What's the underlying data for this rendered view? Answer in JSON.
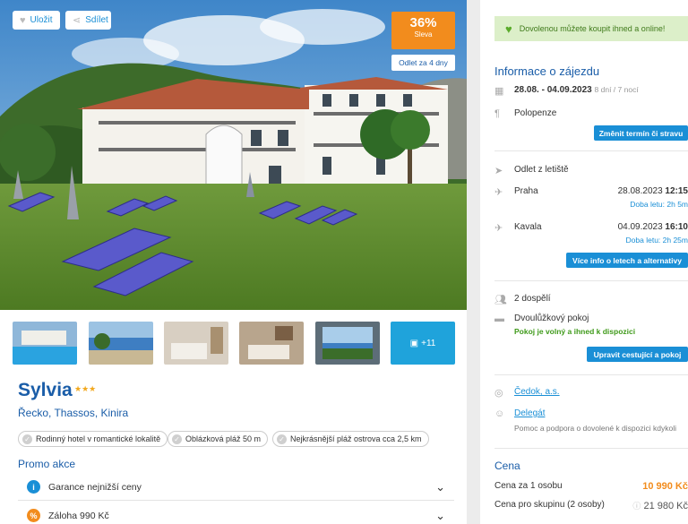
{
  "hero": {
    "save_label": "Uložit",
    "share_label": "Sdílet",
    "discount_pct": "36%",
    "discount_label": "Sleva",
    "departure_badge": "Odlet za 4 dny"
  },
  "gallery": {
    "more_label": "+11"
  },
  "hotel": {
    "name": "Sylvia",
    "stars": "★★★",
    "location": "Řecko, Thassos, Kinira",
    "tags": [
      "Rodinný hotel v romantické lokalitě",
      "Oblázková pláž 50 m",
      "Nejkrásnější pláž ostrova cca 2,5 km"
    ]
  },
  "promo": {
    "title": "Promo akce",
    "items": [
      {
        "label": "Garance nejnižší ceny",
        "icon": "info-icon",
        "color": "#1a8fd6"
      },
      {
        "label": "Záloha 990 Kč",
        "icon": "percent-icon",
        "color": "#f28c1d"
      }
    ]
  },
  "sidebar": {
    "notice": "Dovolenou můžete koupit ihned a online!",
    "trip_title": "Informace o zájezdu",
    "dates": "28.08. - 04.09.2023",
    "duration": "8 dní / 7 nocí",
    "board": "Polopenze",
    "change_btn": "Změnit termín či stravu",
    "flight_title": "Odlet z letiště",
    "outbound": {
      "city": "Praha",
      "date": "28.08.2023",
      "time": "12:15",
      "duration": "Doba letu: 2h 5m"
    },
    "inbound": {
      "city": "Kavala",
      "date": "04.09.2023",
      "time": "16:10",
      "duration": "Doba letu: 2h 25m"
    },
    "flights_btn": "Více info o letech a alternativy",
    "travellers": "2 dospělí",
    "room": "Dvoulůžkový pokoj",
    "room_status": "Pokoj je volný a ihned k dispozici",
    "edit_btn": "Upravit cestující a pokoj",
    "agency": "Čedok, a.s.",
    "rep": "Delegát",
    "rep_note": "Pomoc a podpora o dovolené k dispozici kdykoli",
    "price_title": "Cena",
    "price_person_label": "Cena za 1 osobu",
    "price_person": "10 990 Kč",
    "price_group_label": "Cena pro skupinu (2 osoby)",
    "price_group": "21 980 Kč"
  },
  "colors": {
    "accent": "#1a8fd6",
    "brand_blue": "#1a5da8",
    "orange": "#f28c1d",
    "green": "#5aab2b"
  }
}
